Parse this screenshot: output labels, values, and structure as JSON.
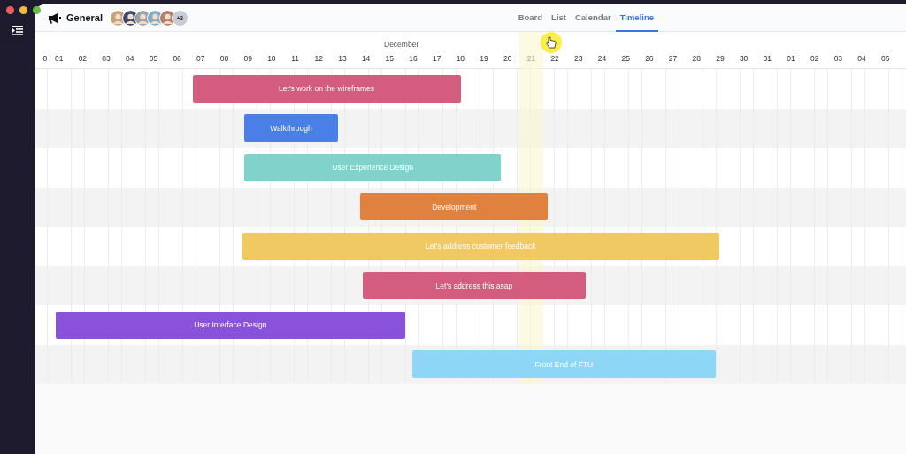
{
  "project": {
    "title": "General",
    "members": [
      {
        "color": "#c9a27a"
      },
      {
        "color": "#3b4a6b"
      },
      {
        "color": "#9aa1a8"
      },
      {
        "color": "#7fb0c8"
      },
      {
        "color": "#b7806a"
      }
    ],
    "more_members": "+3"
  },
  "tabs": [
    {
      "label": "Board",
      "selected": false
    },
    {
      "label": "List",
      "selected": false
    },
    {
      "label": "Calendar",
      "selected": false
    },
    {
      "label": "Timeline",
      "selected": true
    }
  ],
  "timeline": {
    "month": "December",
    "days": [
      {
        "label": "0",
        "highlighted": false
      },
      {
        "label": "01",
        "highlighted": false
      },
      {
        "label": "02",
        "highlighted": false
      },
      {
        "label": "03",
        "highlighted": false
      },
      {
        "label": "04",
        "highlighted": false
      },
      {
        "label": "05",
        "highlighted": false
      },
      {
        "label": "06",
        "highlighted": false
      },
      {
        "label": "07",
        "highlighted": false
      },
      {
        "label": "08",
        "highlighted": false
      },
      {
        "label": "09",
        "highlighted": false
      },
      {
        "label": "10",
        "highlighted": false
      },
      {
        "label": "11",
        "highlighted": false
      },
      {
        "label": "12",
        "highlighted": false
      },
      {
        "label": "13",
        "highlighted": false
      },
      {
        "label": "14",
        "highlighted": false
      },
      {
        "label": "15",
        "highlighted": false
      },
      {
        "label": "16",
        "highlighted": false
      },
      {
        "label": "17",
        "highlighted": false
      },
      {
        "label": "18",
        "highlighted": false
      },
      {
        "label": "19",
        "highlighted": false
      },
      {
        "label": "20",
        "highlighted": false
      },
      {
        "label": "21",
        "highlighted": true
      },
      {
        "label": "22",
        "highlighted": false
      },
      {
        "label": "23",
        "highlighted": false
      },
      {
        "label": "24",
        "highlighted": false
      },
      {
        "label": "25",
        "highlighted": false
      },
      {
        "label": "26",
        "highlighted": false
      },
      {
        "label": "27",
        "highlighted": false
      },
      {
        "label": "28",
        "highlighted": false
      },
      {
        "label": "29",
        "highlighted": false
      },
      {
        "label": "30",
        "highlighted": false
      },
      {
        "label": "31",
        "highlighted": false
      },
      {
        "label": "01",
        "highlighted": false
      },
      {
        "label": "02",
        "highlighted": false
      },
      {
        "label": "03",
        "highlighted": false
      },
      {
        "label": "04",
        "highlighted": false
      },
      {
        "label": "05",
        "highlighted": false
      }
    ],
    "tasks": [
      {
        "label": "Let's work on the wireframes",
        "color": "#d45c7e"
      },
      {
        "label": "Walkthrough",
        "color": "#4a7fe8"
      },
      {
        "label": "User Experience Design",
        "color": "#7fd3cb"
      },
      {
        "label": "Development",
        "color": "#e0823e"
      },
      {
        "label": "Let's address customer feedback",
        "color": "#f0c960"
      },
      {
        "label": "Let's address this asap",
        "color": "#d45c7e"
      },
      {
        "label": "User Interface Design",
        "color": "#8a52d8"
      },
      {
        "label": "Front End of FTU",
        "color": "#8dd6f5"
      }
    ]
  }
}
